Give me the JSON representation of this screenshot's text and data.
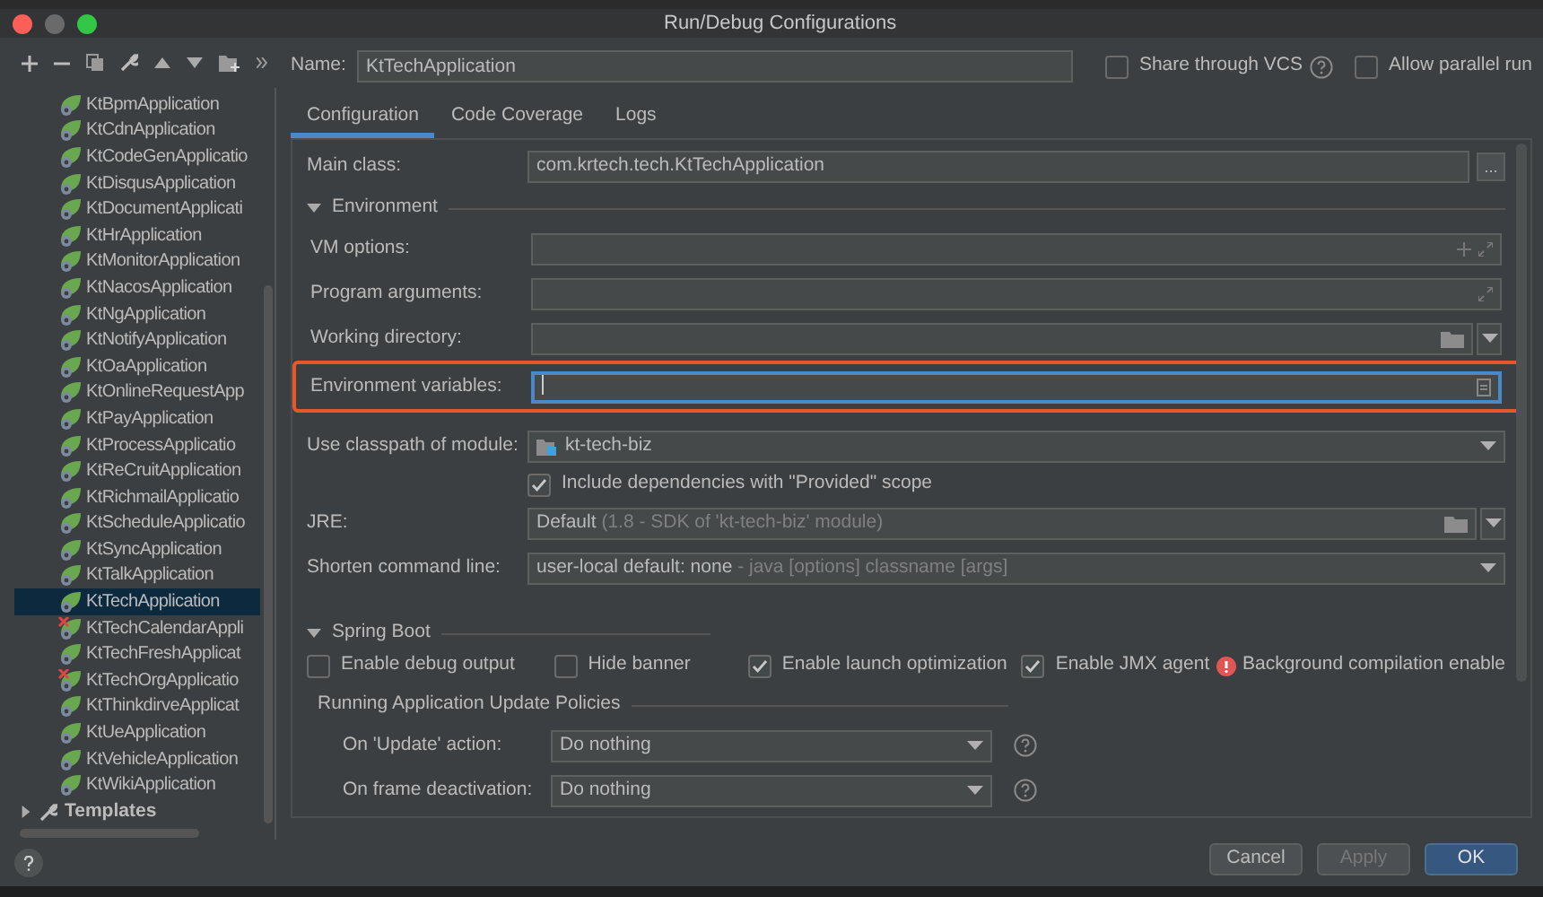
{
  "window": {
    "title": "Run/Debug Configurations"
  },
  "sidebar": {
    "items": [
      {
        "label": "KtBpmApplication",
        "selected": false,
        "error": false
      },
      {
        "label": "KtCdnApplication",
        "selected": false,
        "error": false
      },
      {
        "label": "KtCodeGenApplicatio",
        "selected": false,
        "error": false
      },
      {
        "label": "KtDisqusApplication",
        "selected": false,
        "error": false
      },
      {
        "label": "KtDocumentApplicati",
        "selected": false,
        "error": false
      },
      {
        "label": "KtHrApplication",
        "selected": false,
        "error": false
      },
      {
        "label": "KtMonitorApplication",
        "selected": false,
        "error": false
      },
      {
        "label": "KtNacosApplication",
        "selected": false,
        "error": false
      },
      {
        "label": "KtNgApplication",
        "selected": false,
        "error": false
      },
      {
        "label": "KtNotifyApplication",
        "selected": false,
        "error": false
      },
      {
        "label": "KtOaApplication",
        "selected": false,
        "error": false
      },
      {
        "label": "KtOnlineRequestApp",
        "selected": false,
        "error": false
      },
      {
        "label": "KtPayApplication",
        "selected": false,
        "error": false
      },
      {
        "label": "KtProcessApplicatio",
        "selected": false,
        "error": false
      },
      {
        "label": "KtReCruitApplication",
        "selected": false,
        "error": false
      },
      {
        "label": "KtRichmailApplicatio",
        "selected": false,
        "error": false
      },
      {
        "label": "KtScheduleApplicatio",
        "selected": false,
        "error": false
      },
      {
        "label": "KtSyncApplication",
        "selected": false,
        "error": false
      },
      {
        "label": "KtTalkApplication",
        "selected": false,
        "error": false
      },
      {
        "label": "KtTechApplication",
        "selected": true,
        "error": false
      },
      {
        "label": "KtTechCalendarAppli",
        "selected": false,
        "error": true
      },
      {
        "label": "KtTechFreshApplicat",
        "selected": false,
        "error": false
      },
      {
        "label": "KtTechOrgApplicatio",
        "selected": false,
        "error": true
      },
      {
        "label": "KtThinkdirveApplicat",
        "selected": false,
        "error": false
      },
      {
        "label": "KtUeApplication",
        "selected": false,
        "error": false
      },
      {
        "label": "KtVehicleApplication",
        "selected": false,
        "error": false
      },
      {
        "label": "KtWikiApplication",
        "selected": false,
        "error": false
      }
    ],
    "templates": {
      "label": "Templates",
      "expanded": false
    }
  },
  "name_field": {
    "label": "Name:",
    "value": "KtTechApplication"
  },
  "header_options": [
    {
      "label": "Share through VCS",
      "checked": false,
      "help": true
    },
    {
      "label": "Allow parallel run",
      "checked": false,
      "help": false
    }
  ],
  "tabs": [
    {
      "label": "Configuration",
      "selected": true
    },
    {
      "label": "Code Coverage",
      "selected": false
    },
    {
      "label": "Logs",
      "selected": false
    }
  ],
  "main_class": {
    "label": "Main class:",
    "value": "com.krtech.tech.KtTechApplication",
    "browse": "..."
  },
  "environment": {
    "title": "Environment",
    "expanded": true
  },
  "rows": [
    {
      "kind": "expand_add",
      "label": "VM options:",
      "value": "",
      "highlighted": false
    },
    {
      "kind": "expand",
      "label": "Program arguments:",
      "value": "",
      "highlighted": false
    },
    {
      "kind": "folder",
      "label": "Working directory:",
      "value": "",
      "highlighted": false
    },
    {
      "kind": "env",
      "label": "Environment variables:",
      "value": "",
      "highlighted": true
    }
  ],
  "module": {
    "label": "Use classpath of module:",
    "value": "kt-tech-biz"
  },
  "include_deps": {
    "label": "Include dependencies with \"Provided\" scope",
    "checked": true
  },
  "jre": {
    "label": "JRE:",
    "value": "Default",
    "hint": "(1.8 - SDK of 'kt-tech-biz' module)"
  },
  "shorten": {
    "label": "Shorten command line:",
    "value": "user-local default: none",
    "hint": "- java [options] classname [args]"
  },
  "spring_boot": {
    "title": "Spring Boot",
    "expanded": true,
    "options": [
      {
        "label": "Enable debug output",
        "checked": false
      },
      {
        "label": "Hide banner",
        "checked": false
      },
      {
        "label": "Enable launch optimization",
        "checked": true
      },
      {
        "label": "Enable JMX agent",
        "checked": true
      }
    ],
    "warning": "Background compilation enable"
  },
  "policies": {
    "title": "Running Application Update Policies",
    "rows": [
      {
        "label": "On 'Update' action:",
        "value": "Do nothing"
      },
      {
        "label": "On frame deactivation:",
        "value": "Do nothing"
      }
    ]
  },
  "buttons": [
    {
      "label": "Cancel",
      "kind": "normal",
      "disabled": false
    },
    {
      "label": "Apply",
      "kind": "normal",
      "disabled": true
    },
    {
      "label": "OK",
      "kind": "default",
      "disabled": false
    }
  ]
}
